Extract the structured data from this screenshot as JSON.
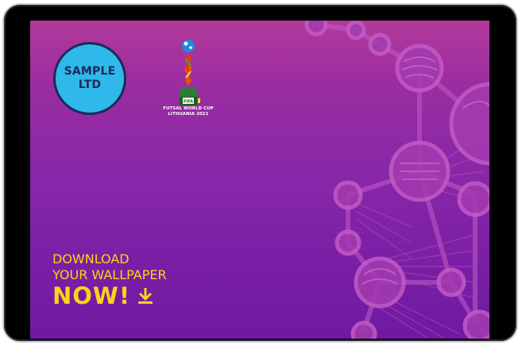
{
  "badge": {
    "line1": "SAMPLE",
    "line2": "LTD"
  },
  "logo": {
    "tag": "FIFA",
    "line1": "FUTSAL WORLD CUP",
    "line2": "LITHUANIA 2021"
  },
  "cta": {
    "line1": "DOWNLOAD",
    "line2": "YOUR WALLPAPER",
    "line3": "NOW!",
    "icon": "download-icon"
  },
  "colors": {
    "accent_yellow": "#ffd21a",
    "badge_blue": "#2fb8ea",
    "background_purple": "#8a28a8",
    "deco_purple": "#b04cb8"
  }
}
